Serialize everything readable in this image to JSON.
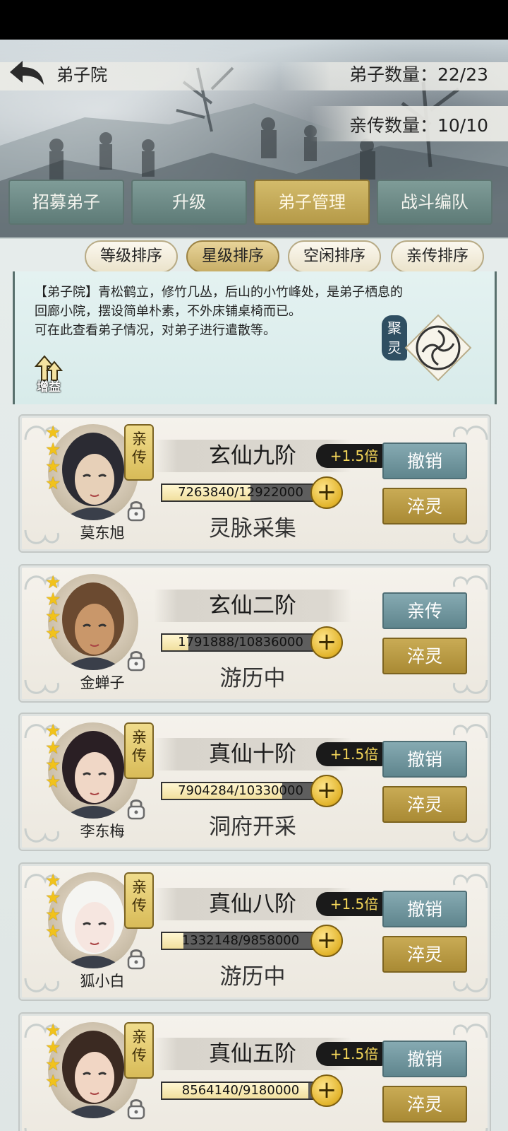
{
  "header": {
    "title": "弟子院",
    "disciple_count": "弟子数量：22/23",
    "inner_disciple_count": "亲传数量：10/10"
  },
  "tabs": [
    {
      "label": "招募弟子"
    },
    {
      "label": "升级"
    },
    {
      "label": "弟子管理",
      "active": true
    },
    {
      "label": "战斗编队"
    }
  ],
  "sort_buttons": [
    {
      "label": "等级排序"
    },
    {
      "label": "星级排序",
      "active": true
    },
    {
      "label": "空闲排序"
    },
    {
      "label": "亲传排序"
    }
  ],
  "info": {
    "line1": "【弟子院】青松鹤立，修竹几丛，后山的小竹峰处，是弟子栖息的",
    "line2": "回廊小院，摆设简单朴素，不外床铺桌椅而已。",
    "line3": "可在此查看弟子情况，对弟子进行遣散等。",
    "buff_label": "增益",
    "gather_label": "聚灵"
  },
  "disciples": [
    {
      "name": "莫东旭",
      "stars": 4,
      "badge": "亲传",
      "rank": "玄仙九阶",
      "bonus": "+1.5倍",
      "progress_text": "7263840/12922000",
      "progress": 0.562,
      "activity": "灵脉采集",
      "action_top": "撤销",
      "action_bottom": "淬灵"
    },
    {
      "name": "金蝉子",
      "stars": 4,
      "badge": "",
      "rank": "玄仙二阶",
      "bonus": "",
      "progress_text": "1791888/10836000",
      "progress": 0.165,
      "activity": "游历中",
      "action_top": "亲传",
      "action_bottom": "淬灵"
    },
    {
      "name": "李东梅",
      "stars": 4,
      "badge": "亲传",
      "rank": "真仙十阶",
      "bonus": "+1.5倍",
      "progress_text": "7904284/10330000",
      "progress": 0.765,
      "activity": "洞府开采",
      "action_top": "撤销",
      "action_bottom": "淬灵"
    },
    {
      "name": "狐小白",
      "stars": 4,
      "badge": "亲传",
      "rank": "真仙八阶",
      "bonus": "+1.5倍",
      "progress_text": "1332148/9858000",
      "progress": 0.135,
      "activity": "游历中",
      "action_top": "撤销",
      "action_bottom": "淬灵"
    },
    {
      "name": "",
      "stars": 4,
      "badge": "亲传",
      "rank": "真仙五阶",
      "bonus": "+1.5倍",
      "progress_text": "8564140/9180000",
      "progress": 0.933,
      "activity": "",
      "action_top": "撤销",
      "action_bottom": "淬灵"
    }
  ],
  "colors": {
    "tab": "#6f8d89",
    "tab_active": "#c6ab5b",
    "action_teal": "#7198a0",
    "action_gold": "#b99a44",
    "star": "#f1c21b"
  }
}
